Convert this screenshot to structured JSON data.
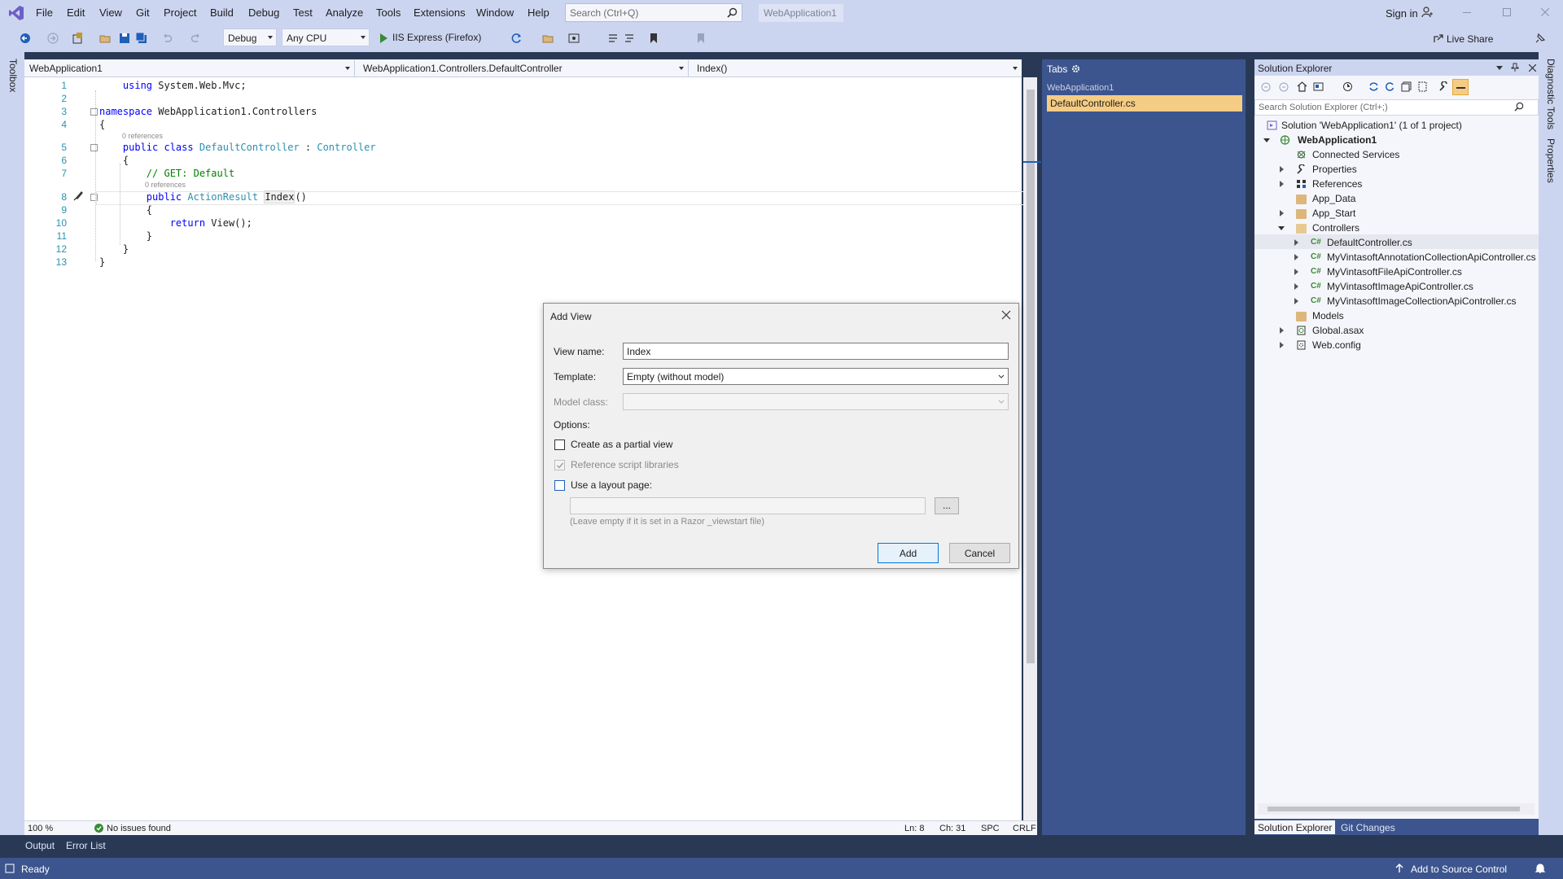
{
  "menu": [
    "File",
    "Edit",
    "View",
    "Git",
    "Project",
    "Build",
    "Debug",
    "Test",
    "Analyze",
    "Tools",
    "Extensions",
    "Window",
    "Help"
  ],
  "search": {
    "placeholder": "Search (Ctrl+Q)"
  },
  "app_title": "WebApplication1",
  "signin": "Sign in",
  "toolbar": {
    "config": "Debug",
    "platform": "Any CPU",
    "run": "IIS Express (Firefox)",
    "live_share": "Live Share"
  },
  "left_rail": {
    "toolbox": "Toolbox"
  },
  "right_rail": {
    "diagnostic": "Diagnostic Tools",
    "properties": "Properties"
  },
  "nav": {
    "project": "WebApplication1",
    "type": "WebApplication1.Controllers.DefaultController",
    "member": "Index()"
  },
  "code": {
    "line_numbers": [
      "1",
      "2",
      "3",
      "4",
      "5",
      "6",
      "7",
      "8",
      "9",
      "10",
      "11",
      "12",
      "13"
    ],
    "l1_kw": "using",
    "l1_rest": " System.Web.Mvc;",
    "l3_kw": "namespace",
    "l3_rest": " WebApplication1.Controllers",
    "brace_open": "{",
    "brace_close": "}",
    "refs": "0 references",
    "l5_kw": "public class",
    "l5_type": "DefaultController",
    "l5_colon": " : ",
    "l5_base": "Controller",
    "l7_comment": "// GET: Default",
    "l8_kw": "public",
    "l8_type": "ActionResult",
    "l8_name": "Index",
    "l8_paren": "()",
    "l10_kw": "return",
    "l10_rest": " View();"
  },
  "editor_status": {
    "zoom": "100 %",
    "issues": "No issues found",
    "ln": "Ln: 8",
    "ch": "Ch: 31",
    "spc": "SPC",
    "crlf": "CRLF"
  },
  "tabs_panel": {
    "title": "Tabs",
    "group": "WebApplication1",
    "active": "DefaultController.cs"
  },
  "solution_explorer": {
    "title": "Solution Explorer",
    "search_placeholder": "Search Solution Explorer (Ctrl+;)",
    "items": [
      {
        "label": "Solution 'WebApplication1' (1 of 1 project)",
        "icon": "solution-icon"
      },
      {
        "label": "WebApplication1",
        "icon": "web-project-icon"
      },
      {
        "label": "Connected Services",
        "icon": "connected-services-icon"
      },
      {
        "label": "Properties",
        "icon": "wrench-icon"
      },
      {
        "label": "References",
        "icon": "references-icon"
      },
      {
        "label": "App_Data",
        "icon": "folder-icon"
      },
      {
        "label": "App_Start",
        "icon": "folder-icon"
      },
      {
        "label": "Controllers",
        "icon": "folder-open-icon"
      },
      {
        "label": "DefaultController.cs",
        "icon": "csharp-file-icon"
      },
      {
        "label": "MyVintasoftAnnotationCollectionApiController.cs",
        "icon": "csharp-file-icon"
      },
      {
        "label": "MyVintasoftFileApiController.cs",
        "icon": "csharp-file-icon"
      },
      {
        "label": "MyVintasoftImageApiController.cs",
        "icon": "csharp-file-icon"
      },
      {
        "label": "MyVintasoftImageCollectionApiController.cs",
        "icon": "csharp-file-icon"
      },
      {
        "label": "Models",
        "icon": "folder-icon"
      },
      {
        "label": "Global.asax",
        "icon": "global-asax-icon"
      },
      {
        "label": "Web.config",
        "icon": "config-file-icon"
      }
    ],
    "tabs": [
      "Solution Explorer",
      "Git Changes"
    ]
  },
  "bottom_tabs": [
    "Output",
    "Error List"
  ],
  "statusbar": {
    "ready": "Ready",
    "source_control": "Add to Source Control"
  },
  "dialog": {
    "title": "Add View",
    "view_name_label": "View name:",
    "view_name_value": "Index",
    "template_label": "Template:",
    "template_value": "Empty (without model)",
    "model_class_label": "Model class:",
    "options_label": "Options:",
    "partial_label": "Create as a partial view",
    "partial_checked": false,
    "scripts_label": "Reference script libraries",
    "scripts_checked": true,
    "layout_label": "Use a layout page:",
    "layout_checked": false,
    "browse_label": "...",
    "layout_hint": "(Leave empty if it is set in a Razor _viewstart file)",
    "add_label": "Add",
    "cancel_label": "Cancel"
  },
  "colors": {
    "chrome": "#ccd5f0",
    "dark": "#293955",
    "panel": "#3c558e",
    "tab_active": "#f5cc84",
    "keyword": "#0000ff",
    "type": "#2b91af",
    "comment": "#008000"
  }
}
